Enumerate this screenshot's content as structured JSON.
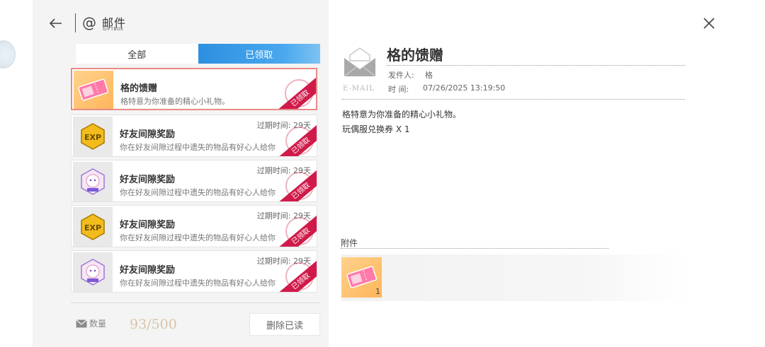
{
  "header": {
    "title": "邮件",
    "subtitle": "GIFTBOX"
  },
  "tabs": [
    {
      "label": "全部",
      "active": false
    },
    {
      "label": "已领取",
      "active": true
    }
  ],
  "mails": [
    {
      "title": "格的馈赠",
      "desc": "格特意为你准备的精心小礼物。",
      "expire": "",
      "icon": "ticket-icon",
      "stamp": "已领取",
      "selected": true
    },
    {
      "title": "好友间隙奖励",
      "desc": "你在好友间隙过程中遗失的物品有好心人给你",
      "expire": "过期时间: 29天",
      "icon": "exp-icon",
      "stamp": "已领取",
      "selected": false
    },
    {
      "title": "好友间隙奖励",
      "desc": "你在好友间隙过程中遗失的物品有好心人给你",
      "expire": "过期时间: 29天",
      "icon": "neko-icon",
      "stamp": "已领取",
      "selected": false
    },
    {
      "title": "好友间隙奖励",
      "desc": "你在好友间隙过程中遗失的物品有好心人给你",
      "expire": "过期时间: 29天",
      "icon": "exp-icon",
      "stamp": "已领取",
      "selected": false
    },
    {
      "title": "好友间隙奖励",
      "desc": "你在好友间隙过程中遗失的物品有好心人给你",
      "expire": "过期时间: 29天",
      "icon": "neko-icon",
      "stamp": "已领取",
      "selected": false
    }
  ],
  "footer": {
    "quota_label": "数量",
    "quota_count": "93/500",
    "delete_label": "删除已读"
  },
  "detail": {
    "title": "格的馈赠",
    "sender_label": "发件人:",
    "sender": "格",
    "time_label": "时  间:",
    "time": "07/26/2025 13:19:50",
    "email_label": "E-MAIL",
    "body": [
      "格特意为你准备的精心小礼物。",
      "玩偶服兑换券 X 1"
    ],
    "attach_label": "附件",
    "attach_qty": "1"
  },
  "colors": {
    "tab_active": "#2d8fe0",
    "stamp": "#d01a4a",
    "selected_border": "#e98a86",
    "quota_count": "#d8c6a6"
  }
}
